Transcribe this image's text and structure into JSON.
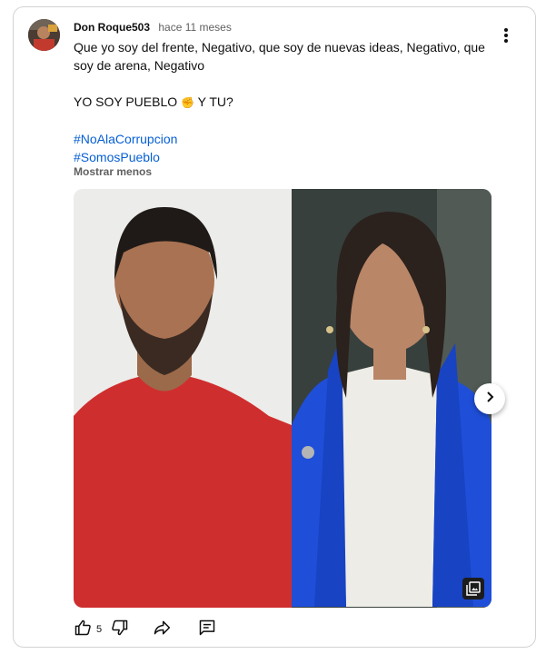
{
  "post": {
    "author": "Don Roque503",
    "time": "hace 11 meses",
    "line1": "Que yo soy del frente, Negativo, que soy de nuevas ideas, Negativo, que soy de arena, Negativo",
    "line2_before": "YO SOY PUEBLO",
    "line2_emoji": "✊",
    "line2_after": " Y TU?",
    "hashtags": [
      "#NoAlaCorrupcion",
      "#SomosPueblo"
    ],
    "show_less": "Mostrar menos"
  },
  "actions": {
    "like_count": "5"
  },
  "icons": {
    "menu": "more-vert-icon",
    "next": "chevron-right-icon",
    "gallery": "image-gallery-icon",
    "like": "thumb-up-icon",
    "dislike": "thumb-down-icon",
    "share": "share-icon",
    "comment": "comment-icon"
  }
}
